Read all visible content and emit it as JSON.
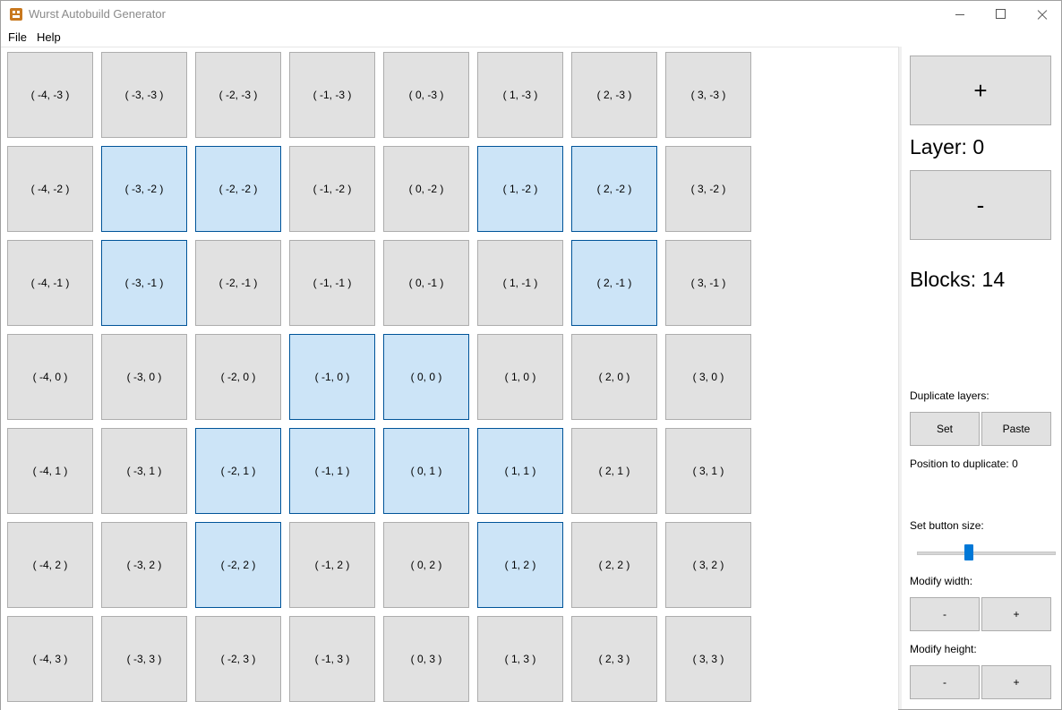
{
  "window": {
    "title": "Wurst Autobuild Generator"
  },
  "menu": {
    "file": "File",
    "help": "Help"
  },
  "grid": {
    "rows": [
      [
        {
          "label": "( -4, -3 )",
          "on": false
        },
        {
          "label": "( -3, -3 )",
          "on": false
        },
        {
          "label": "( -2, -3 )",
          "on": false
        },
        {
          "label": "( -1, -3 )",
          "on": false
        },
        {
          "label": "( 0, -3 )",
          "on": false
        },
        {
          "label": "( 1, -3 )",
          "on": false
        },
        {
          "label": "( 2, -3 )",
          "on": false
        },
        {
          "label": "( 3, -3 )",
          "on": false
        }
      ],
      [
        {
          "label": "( -4, -2 )",
          "on": false
        },
        {
          "label": "( -3, -2 )",
          "on": true
        },
        {
          "label": "( -2, -2 )",
          "on": true
        },
        {
          "label": "( -1, -2 )",
          "on": false
        },
        {
          "label": "( 0, -2 )",
          "on": false
        },
        {
          "label": "( 1, -2 )",
          "on": true
        },
        {
          "label": "( 2, -2 )",
          "on": true
        },
        {
          "label": "( 3, -2 )",
          "on": false
        }
      ],
      [
        {
          "label": "( -4, -1 )",
          "on": false
        },
        {
          "label": "( -3, -1 )",
          "on": true
        },
        {
          "label": "( -2, -1 )",
          "on": false
        },
        {
          "label": "( -1, -1 )",
          "on": false
        },
        {
          "label": "( 0, -1 )",
          "on": false
        },
        {
          "label": "( 1, -1 )",
          "on": false
        },
        {
          "label": "( 2, -1 )",
          "on": true
        },
        {
          "label": "( 3, -1 )",
          "on": false
        }
      ],
      [
        {
          "label": "( -4, 0 )",
          "on": false
        },
        {
          "label": "( -3, 0 )",
          "on": false
        },
        {
          "label": "( -2, 0 )",
          "on": false
        },
        {
          "label": "( -1, 0 )",
          "on": true
        },
        {
          "label": "( 0, 0 )",
          "on": true
        },
        {
          "label": "( 1, 0 )",
          "on": false
        },
        {
          "label": "( 2, 0 )",
          "on": false
        },
        {
          "label": "( 3, 0 )",
          "on": false
        }
      ],
      [
        {
          "label": "( -4, 1 )",
          "on": false
        },
        {
          "label": "( -3, 1 )",
          "on": false
        },
        {
          "label": "( -2, 1 )",
          "on": true
        },
        {
          "label": "( -1, 1 )",
          "on": true
        },
        {
          "label": "( 0, 1 )",
          "on": true
        },
        {
          "label": "( 1, 1 )",
          "on": true
        },
        {
          "label": "( 2, 1 )",
          "on": false
        },
        {
          "label": "( 3, 1 )",
          "on": false
        }
      ],
      [
        {
          "label": "( -4, 2 )",
          "on": false
        },
        {
          "label": "( -3, 2 )",
          "on": false
        },
        {
          "label": "( -2, 2 )",
          "on": true
        },
        {
          "label": "( -1, 2 )",
          "on": false
        },
        {
          "label": "( 0, 2 )",
          "on": false
        },
        {
          "label": "( 1, 2 )",
          "on": true
        },
        {
          "label": "( 2, 2 )",
          "on": false
        },
        {
          "label": "( 3, 2 )",
          "on": false
        }
      ],
      [
        {
          "label": "( -4, 3 )",
          "on": false
        },
        {
          "label": "( -3, 3 )",
          "on": false
        },
        {
          "label": "( -2, 3 )",
          "on": false
        },
        {
          "label": "( -1, 3 )",
          "on": false
        },
        {
          "label": "( 0, 3 )",
          "on": false
        },
        {
          "label": "( 1, 3 )",
          "on": false
        },
        {
          "label": "( 2, 3 )",
          "on": false
        },
        {
          "label": "( 3, 3 )",
          "on": false
        }
      ]
    ]
  },
  "panel": {
    "layer_up": "+",
    "layer_text": "Layer: 0",
    "layer_down": "-",
    "blocks_text": "Blocks: 14",
    "duplicate_label": "Duplicate layers:",
    "set_label": "Set",
    "paste_label": "Paste",
    "position_text": "Position to duplicate: 0",
    "button_size_label": "Set button size:",
    "button_size_level": 0.38,
    "width_label": "Modify width:",
    "width_minus": "-",
    "width_plus": "+",
    "height_label": "Modify height:",
    "height_minus": "-",
    "height_plus": "+"
  },
  "colors": {
    "cell_default": "#e1e1e1",
    "cell_selected": "#cce4f7",
    "cell_selected_border": "#005499",
    "slider_accent": "#0078d7"
  }
}
